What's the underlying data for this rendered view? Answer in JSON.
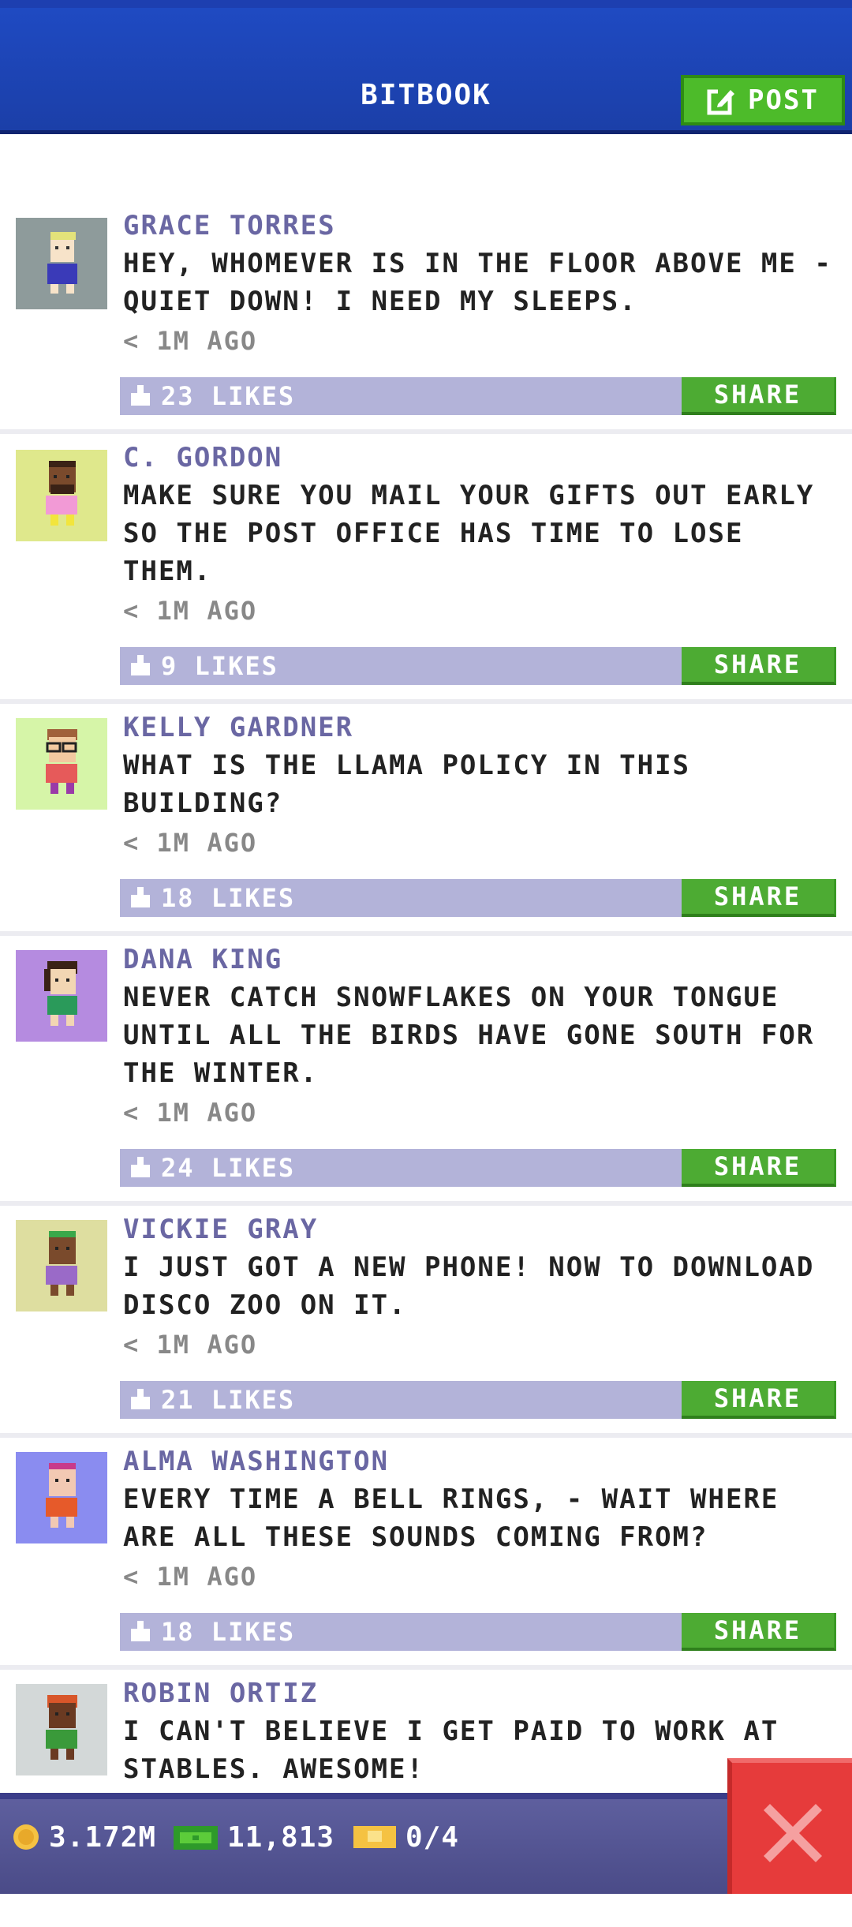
{
  "header": {
    "title": "BITBOOK",
    "post_label": "POST"
  },
  "posts": [
    {
      "name": "GRACE TORRES",
      "text": "HEY, WHOMEVER IS IN THE FLOOR ABOVE ME - QUIET DOWN! I NEED MY SLEEPS.",
      "time": "< 1M AGO",
      "likes": "23 LIKES",
      "share": "SHARE"
    },
    {
      "name": "C. GORDON",
      "text": "MAKE SURE YOU MAIL YOUR GIFTS OUT EARLY SO THE POST OFFICE HAS TIME TO LOSE THEM.",
      "time": "< 1M AGO",
      "likes": "9 LIKES",
      "share": "SHARE"
    },
    {
      "name": "KELLY GARDNER",
      "text": "WHAT IS THE LLAMA POLICY IN THIS BUILDING?",
      "time": "< 1M AGO",
      "likes": "18 LIKES",
      "share": "SHARE"
    },
    {
      "name": "DANA KING",
      "text": "NEVER CATCH SNOWFLAKES ON YOUR TONGUE UNTIL ALL THE BIRDS HAVE GONE SOUTH FOR THE WINTER.",
      "time": "< 1M AGO",
      "likes": "24 LIKES",
      "share": "SHARE"
    },
    {
      "name": "VICKIE GRAY",
      "text": "I JUST GOT A NEW PHONE! NOW TO DOWNLOAD DISCO ZOO ON IT.",
      "time": "< 1M AGO",
      "likes": "21 LIKES",
      "share": "SHARE"
    },
    {
      "name": "ALMA WASHINGTON",
      "text": "EVERY TIME A BELL RINGS, - WAIT WHERE ARE ALL THESE SOUNDS COMING FROM?",
      "time": "< 1M AGO",
      "likes": "18 LIKES",
      "share": "SHARE"
    },
    {
      "name": "ROBIN ORTIZ",
      "text": "I CAN'T BELIEVE I GET PAID TO WORK AT STABLES. AWESOME!"
    }
  ],
  "status": {
    "coins": "3.172M",
    "bux": "11,813",
    "tickets": "0/4"
  },
  "colors": {
    "header_blue": "#1f4ac2",
    "name_purple": "#6a67a3",
    "likes_bar": "#b3b3d9",
    "share_green": "#4dab33",
    "close_red": "#e63b3b"
  }
}
